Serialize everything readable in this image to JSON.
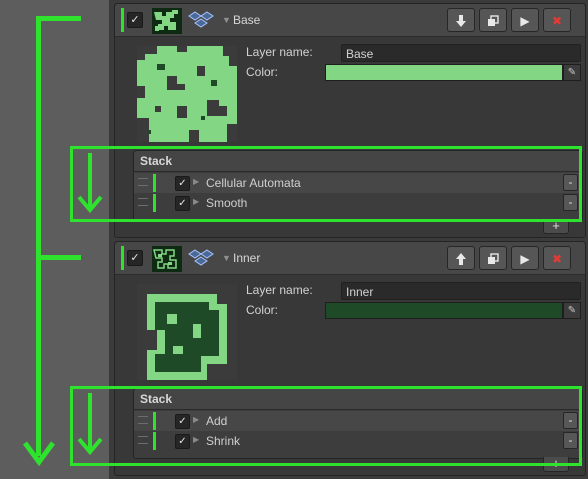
{
  "colors": {
    "accent": "#2ee22e",
    "base_color": "#83d683",
    "inner_color": "#1f4a27",
    "remove": "#e53935"
  },
  "layers": [
    {
      "title": "Base",
      "toggle_state": "checked",
      "move_icon": "arrow-down-icon",
      "fields": {
        "name_label": "Layer name:",
        "name_value": "Base",
        "color_label": "Color:"
      },
      "stack": {
        "title": "Stack",
        "items": [
          {
            "label": "Cellular Automata",
            "enabled_state": "checked"
          },
          {
            "label": "Smooth",
            "enabled_state": "checked"
          }
        ],
        "remove_label": "-",
        "add_label": "+"
      }
    },
    {
      "title": "Inner",
      "toggle_state": "checked",
      "move_icon": "arrow-up-icon",
      "fields": {
        "name_label": "Layer name:",
        "name_value": "Inner",
        "color_label": "Color:"
      },
      "stack": {
        "title": "Stack",
        "items": [
          {
            "label": "Add",
            "enabled_state": "checked"
          },
          {
            "label": "Shrink",
            "enabled_state": "checked"
          }
        ],
        "remove_label": "-",
        "add_label": "+"
      }
    }
  ],
  "glyphs": {
    "check": "✓",
    "play": "▶",
    "close": "✖",
    "tri_down": "▼",
    "tri_right": "▶",
    "eyedrop": "✎",
    "arrow_down": "🠗",
    "arrow_up": "🠕"
  }
}
